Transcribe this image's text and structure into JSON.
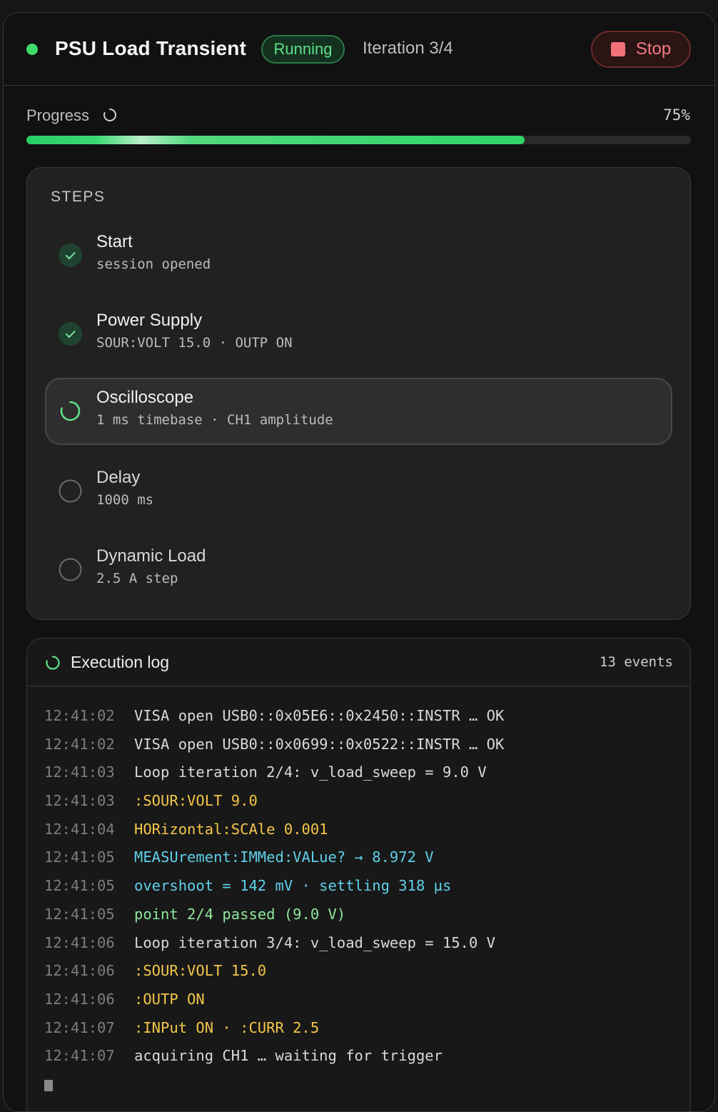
{
  "header": {
    "title": "PSU Load Transient",
    "status": "Running",
    "iteration": "Iteration 3/4",
    "stop_label": "Stop",
    "colors": {
      "status_dot": "#3ddc6a",
      "badge_text": "#5fe08a",
      "stop": "#f37a80"
    }
  },
  "progress": {
    "label": "Progress",
    "percent_text": "75%",
    "value": 0.75,
    "spinner_icon": "loading-spinner-icon"
  },
  "steps": {
    "heading": "STEPS",
    "items": [
      {
        "title": "Start",
        "subtitle": "session opened",
        "state": "done",
        "icon": "check-circle-icon"
      },
      {
        "title": "Power Supply",
        "subtitle": "SOUR:VOLT 15.0 · OUTP ON",
        "state": "done",
        "icon": "check-circle-icon"
      },
      {
        "title": "Oscilloscope",
        "subtitle": "1 ms timebase · CH1 amplitude",
        "state": "active",
        "icon": "loading-spinner-icon"
      },
      {
        "title": "Delay",
        "subtitle": "1000 ms",
        "state": "pending",
        "icon": "empty-circle-icon"
      },
      {
        "title": "Dynamic Load",
        "subtitle": "2.5 A step",
        "state": "pending",
        "icon": "empty-circle-icon"
      }
    ]
  },
  "log": {
    "title": "Execution log",
    "count": "13 events",
    "entries": [
      {
        "time": "12:41:02",
        "msg": "VISA open USB0::0x05E6::0x2450::INSTR … OK",
        "kind": "info"
      },
      {
        "time": "12:41:02",
        "msg": "VISA open USB0::0x0699::0x0522::INSTR … OK",
        "kind": "info"
      },
      {
        "time": "12:41:03",
        "msg": "Loop iteration 2/4: v_load_sweep = 9.0 V",
        "kind": "info"
      },
      {
        "time": "12:41:03",
        "msg": ":SOUR:VOLT 9.0",
        "kind": "cmd"
      },
      {
        "time": "12:41:04",
        "msg": "HORizontal:SCAle 0.001",
        "kind": "cmd"
      },
      {
        "time": "12:41:05",
        "msg": "MEASUrement:IMMed:VALue? → 8.972 V",
        "kind": "query"
      },
      {
        "time": "12:41:05",
        "msg": "overshoot = 142 mV · settling 318 µs",
        "kind": "query"
      },
      {
        "time": "12:41:05",
        "msg": "point 2/4 passed (9.0 V)",
        "kind": "ok"
      },
      {
        "time": "12:41:06",
        "msg": "Loop iteration 3/4: v_load_sweep = 15.0 V",
        "kind": "info"
      },
      {
        "time": "12:41:06",
        "msg": ":SOUR:VOLT 15.0",
        "kind": "cmd"
      },
      {
        "time": "12:41:06",
        "msg": ":OUTP ON",
        "kind": "cmd"
      },
      {
        "time": "12:41:07",
        "msg": ":INPut ON · :CURR 2.5",
        "kind": "cmd"
      },
      {
        "time": "12:41:07",
        "msg": "acquiring CH1 … waiting for trigger",
        "kind": "info"
      }
    ]
  }
}
